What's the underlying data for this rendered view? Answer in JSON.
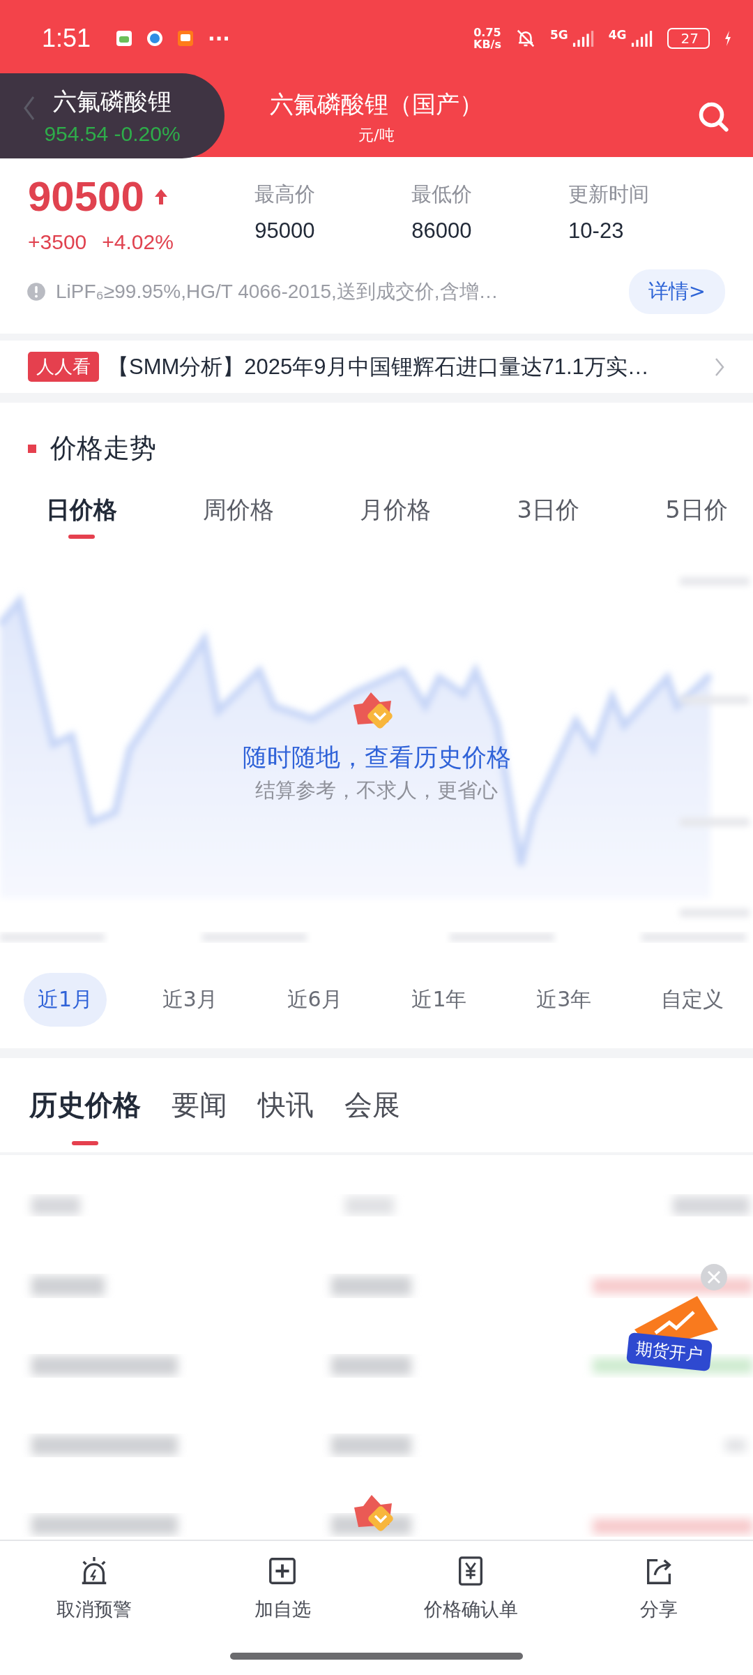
{
  "status_bar": {
    "time": "1:51",
    "more": "···",
    "speed_value": "0.75",
    "speed_unit": "KB/s",
    "network_1": "5G",
    "network_2": "4G",
    "battery": "27"
  },
  "header": {
    "title": "六氟磷酸锂（国产）",
    "unit": "元/吨",
    "floating_quote": {
      "name": "六氟磷酸锂",
      "price": "954.54",
      "change": "-0.20%"
    }
  },
  "quote": {
    "price": "90500",
    "change": "+3500",
    "change_pct": "+4.02%",
    "stats": [
      {
        "label": "最高价",
        "value": "95000"
      },
      {
        "label": "最低价",
        "value": "86000"
      },
      {
        "label": "更新时间",
        "value": "10-23"
      }
    ],
    "note": "LiPF₆≥99.95%,HG/T 4066-2015,送到成交价,含增…",
    "detail_button": "详情>"
  },
  "news": {
    "badge": "人人看",
    "headline": "【SMM分析】2025年9月中国锂辉石进口量达71.1万实…"
  },
  "trend": {
    "title": "价格走势",
    "tabs": [
      {
        "label": "日价格",
        "selected": true
      },
      {
        "label": "周价格",
        "selected": false
      },
      {
        "label": "月价格",
        "selected": false
      },
      {
        "label": "3日价",
        "selected": false
      },
      {
        "label": "5日价",
        "selected": false
      }
    ],
    "promo": {
      "title": "随时随地，查看历史价格",
      "subtitle": "结算参考，不求人，更省心"
    },
    "ranges": [
      {
        "label": "近1月",
        "selected": true
      },
      {
        "label": "近3月",
        "selected": false
      },
      {
        "label": "近6月",
        "selected": false
      },
      {
        "label": "近1年",
        "selected": false
      },
      {
        "label": "近3年",
        "selected": false
      },
      {
        "label": "自定义",
        "selected": false
      }
    ]
  },
  "content_tabs": [
    {
      "label": "历史价格",
      "selected": true
    },
    {
      "label": "要闻",
      "selected": false
    },
    {
      "label": "快讯",
      "selected": false
    },
    {
      "label": "会展",
      "selected": false
    }
  ],
  "ad": {
    "label": "期货开户"
  },
  "bottom_nav": [
    {
      "label": "取消预警"
    },
    {
      "label": "加自选"
    },
    {
      "label": "价格确认单"
    },
    {
      "label": "分享"
    }
  ]
}
